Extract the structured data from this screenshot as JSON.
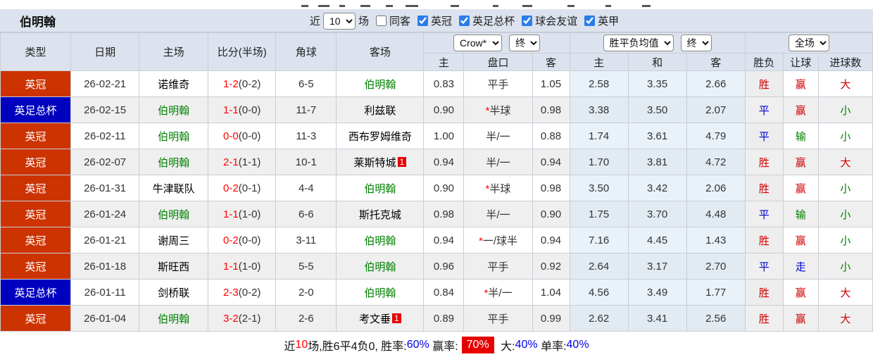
{
  "band": {
    "team_title": "伯明翰",
    "near_label": "近",
    "games_value": "10",
    "games_suffix": "场",
    "same_away_label": "同客",
    "league_filters": [
      {
        "label": "英冠",
        "checked": true
      },
      {
        "label": "英足总杯",
        "checked": true
      },
      {
        "label": "球会友谊",
        "checked": true
      },
      {
        "label": "英甲",
        "checked": true
      }
    ]
  },
  "selects": {
    "odds_company": "Crow*",
    "odds_time_asian": "终",
    "europe_mode": "胜平负均值",
    "odds_time_europe": "终",
    "scope": "全场"
  },
  "columns": [
    "类型",
    "日期",
    "主场",
    "比分(半场)",
    "角球",
    "客场"
  ],
  "subheaders": [
    "主",
    "盘口",
    "客",
    "主",
    "和",
    "客",
    "胜负",
    "让球",
    "进球数"
  ],
  "colors": {
    "league_red": "#cc3300",
    "league_blue": "#0000bf",
    "win_red": "#d10000",
    "draw_blue": "#0000d0",
    "lose_green": "#008000",
    "team_green": "#008000",
    "team_black": "#000000",
    "score_red": "#ff0000",
    "badge_red": "#e60000"
  },
  "rows": [
    {
      "league": "英冠",
      "league_bg": "#cc3300",
      "date": "26-02-21",
      "home": "诺维奇",
      "home_color": "#000000",
      "score": "1-2",
      "half": "(0-2)",
      "corners": "6-5",
      "away": "伯明翰",
      "away_color": "#008000",
      "away_badge": "",
      "ah_home": "0.83",
      "ah_star": "",
      "ah_line": "平手",
      "ah_away": "1.05",
      "eu_home": "2.58",
      "eu_draw": "3.35",
      "eu_away": "2.66",
      "wdl": "胜",
      "wdl_color": "#d10000",
      "ah_res": "赢",
      "ah_res_color": "#d10000",
      "ou_res": "大",
      "ou_res_color": "#d10000"
    },
    {
      "league": "英足总杯",
      "league_bg": "#0000bf",
      "date": "26-02-15",
      "home": "伯明翰",
      "home_color": "#008000",
      "score": "1-1",
      "half": "(0-0)",
      "corners": "11-7",
      "away": "利兹联",
      "away_color": "#000000",
      "away_badge": "",
      "ah_home": "0.90",
      "ah_star": "*",
      "ah_line": "半球",
      "ah_away": "0.98",
      "eu_home": "3.38",
      "eu_draw": "3.50",
      "eu_away": "2.07",
      "wdl": "平",
      "wdl_color": "#0000d0",
      "ah_res": "赢",
      "ah_res_color": "#d10000",
      "ou_res": "小",
      "ou_res_color": "#008000"
    },
    {
      "league": "英冠",
      "league_bg": "#cc3300",
      "date": "26-02-11",
      "home": "伯明翰",
      "home_color": "#008000",
      "score": "0-0",
      "half": "(0-0)",
      "corners": "11-3",
      "away": "西布罗姆维奇",
      "away_color": "#000000",
      "away_badge": "",
      "ah_home": "1.00",
      "ah_star": "",
      "ah_line": "半/一",
      "ah_away": "0.88",
      "eu_home": "1.74",
      "eu_draw": "3.61",
      "eu_away": "4.79",
      "wdl": "平",
      "wdl_color": "#0000d0",
      "ah_res": "输",
      "ah_res_color": "#008000",
      "ou_res": "小",
      "ou_res_color": "#008000"
    },
    {
      "league": "英冠",
      "league_bg": "#cc3300",
      "date": "26-02-07",
      "home": "伯明翰",
      "home_color": "#008000",
      "score": "2-1",
      "half": "(1-1)",
      "corners": "10-1",
      "away": "莱斯特城",
      "away_color": "#000000",
      "away_badge": "1",
      "ah_home": "0.94",
      "ah_star": "",
      "ah_line": "半/一",
      "ah_away": "0.94",
      "eu_home": "1.70",
      "eu_draw": "3.81",
      "eu_away": "4.72",
      "wdl": "胜",
      "wdl_color": "#d10000",
      "ah_res": "赢",
      "ah_res_color": "#d10000",
      "ou_res": "大",
      "ou_res_color": "#d10000"
    },
    {
      "league": "英冠",
      "league_bg": "#cc3300",
      "date": "26-01-31",
      "home": "牛津联队",
      "home_color": "#000000",
      "score": "0-2",
      "half": "(0-1)",
      "corners": "4-4",
      "away": "伯明翰",
      "away_color": "#008000",
      "away_badge": "",
      "ah_home": "0.90",
      "ah_star": "*",
      "ah_line": "半球",
      "ah_away": "0.98",
      "eu_home": "3.50",
      "eu_draw": "3.42",
      "eu_away": "2.06",
      "wdl": "胜",
      "wdl_color": "#d10000",
      "ah_res": "赢",
      "ah_res_color": "#d10000",
      "ou_res": "小",
      "ou_res_color": "#008000"
    },
    {
      "league": "英冠",
      "league_bg": "#cc3300",
      "date": "26-01-24",
      "home": "伯明翰",
      "home_color": "#008000",
      "score": "1-1",
      "half": "(1-0)",
      "corners": "6-6",
      "away": "斯托克城",
      "away_color": "#000000",
      "away_badge": "",
      "ah_home": "0.98",
      "ah_star": "",
      "ah_line": "半/一",
      "ah_away": "0.90",
      "eu_home": "1.75",
      "eu_draw": "3.70",
      "eu_away": "4.48",
      "wdl": "平",
      "wdl_color": "#0000d0",
      "ah_res": "输",
      "ah_res_color": "#008000",
      "ou_res": "小",
      "ou_res_color": "#008000"
    },
    {
      "league": "英冠",
      "league_bg": "#cc3300",
      "date": "26-01-21",
      "home": "谢周三",
      "home_color": "#000000",
      "score": "0-2",
      "half": "(0-0)",
      "corners": "3-11",
      "away": "伯明翰",
      "away_color": "#008000",
      "away_badge": "",
      "ah_home": "0.94",
      "ah_star": "*",
      "ah_line": "一/球半",
      "ah_away": "0.94",
      "eu_home": "7.16",
      "eu_draw": "4.45",
      "eu_away": "1.43",
      "wdl": "胜",
      "wdl_color": "#d10000",
      "ah_res": "赢",
      "ah_res_color": "#d10000",
      "ou_res": "小",
      "ou_res_color": "#008000"
    },
    {
      "league": "英冠",
      "league_bg": "#cc3300",
      "date": "26-01-18",
      "home": "斯旺西",
      "home_color": "#000000",
      "score": "1-1",
      "half": "(1-0)",
      "corners": "5-5",
      "away": "伯明翰",
      "away_color": "#008000",
      "away_badge": "",
      "ah_home": "0.96",
      "ah_star": "",
      "ah_line": "平手",
      "ah_away": "0.92",
      "eu_home": "2.64",
      "eu_draw": "3.17",
      "eu_away": "2.70",
      "wdl": "平",
      "wdl_color": "#0000d0",
      "ah_res": "走",
      "ah_res_color": "#0000d0",
      "ou_res": "小",
      "ou_res_color": "#008000"
    },
    {
      "league": "英足总杯",
      "league_bg": "#0000bf",
      "date": "26-01-11",
      "home": "剑桥联",
      "home_color": "#000000",
      "score": "2-3",
      "half": "(0-2)",
      "corners": "2-0",
      "away": "伯明翰",
      "away_color": "#008000",
      "away_badge": "",
      "ah_home": "0.84",
      "ah_star": "*",
      "ah_line": "半/一",
      "ah_away": "1.04",
      "eu_home": "4.56",
      "eu_draw": "3.49",
      "eu_away": "1.77",
      "wdl": "胜",
      "wdl_color": "#d10000",
      "ah_res": "赢",
      "ah_res_color": "#d10000",
      "ou_res": "大",
      "ou_res_color": "#d10000"
    },
    {
      "league": "英冠",
      "league_bg": "#cc3300",
      "date": "26-01-04",
      "home": "伯明翰",
      "home_color": "#008000",
      "score": "3-2",
      "half": "(2-1)",
      "corners": "2-6",
      "away": "考文垂",
      "away_color": "#000000",
      "away_badge": "1",
      "ah_home": "0.89",
      "ah_star": "",
      "ah_line": "平手",
      "ah_away": "0.99",
      "eu_home": "2.62",
      "eu_draw": "3.41",
      "eu_away": "2.56",
      "wdl": "胜",
      "wdl_color": "#d10000",
      "ah_res": "赢",
      "ah_res_color": "#d10000",
      "ou_res": "大",
      "ou_res_color": "#d10000"
    }
  ],
  "footer": {
    "near": "近",
    "count": "10",
    "summary": "场,胜6平4负0, 胜率:",
    "win_rate": "60%",
    "label2": " 赢率:",
    "handicap_rate": "70%",
    "label3": " 大:",
    "big_rate": "40%",
    "label4": " 单率:",
    "single_rate": "40%"
  }
}
